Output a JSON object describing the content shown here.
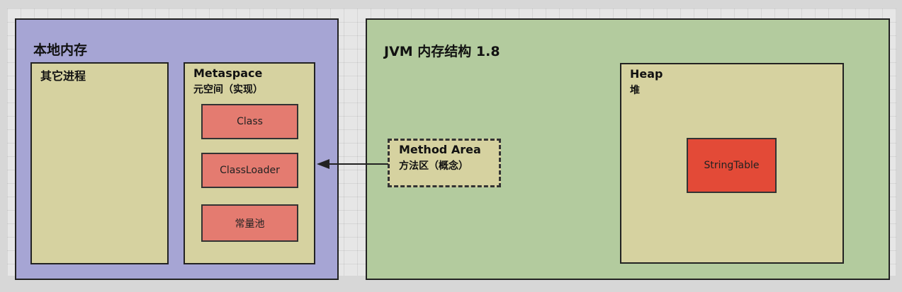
{
  "native_memory": {
    "title": "本地内存",
    "other_process": {
      "label": "其它进程"
    },
    "metaspace": {
      "title": "Metaspace",
      "subtitle": "元空间（实现）",
      "items": [
        "Class",
        "ClassLoader",
        "常量池"
      ]
    }
  },
  "jvm": {
    "title": "JVM 内存结构 1.8",
    "method_area": {
      "title": "Method Area",
      "subtitle": "方法区（概念）"
    },
    "heap": {
      "title": "Heap",
      "subtitle": "堆",
      "string_table": "StringTable"
    }
  },
  "colors": {
    "native_panel": "#a6a5d4",
    "jvm_panel": "#b3cb9e",
    "box_fill": "#d6d2a0",
    "item_fill": "#e47b70",
    "string_table_fill": "#e34a37"
  }
}
